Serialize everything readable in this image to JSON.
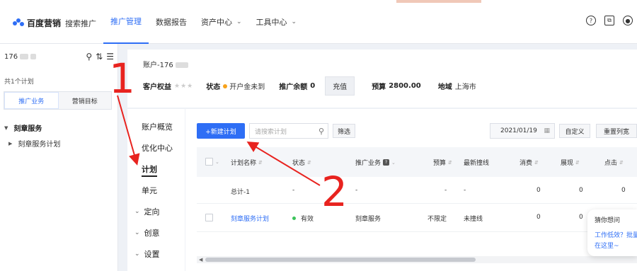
{
  "header": {
    "brand": "百度营销",
    "product": "搜索推广",
    "nav": [
      {
        "label": "推广管理",
        "active": true,
        "dropdown": false
      },
      {
        "label": "数据报告",
        "active": false,
        "dropdown": false
      },
      {
        "label": "资产中心",
        "active": false,
        "dropdown": true
      },
      {
        "label": "工具中心",
        "active": false,
        "dropdown": true
      }
    ],
    "icons": [
      "help-icon",
      "copy-icon",
      "user-icon"
    ]
  },
  "sidebar": {
    "account_prefix": "176",
    "plan_count": "共1个计划",
    "tabs": [
      {
        "label": "推广业务",
        "active": true
      },
      {
        "label": "营销目标",
        "active": false
      }
    ],
    "group": "刻章服务",
    "item": "刻章服务计划"
  },
  "account": {
    "title": "账户-176",
    "rights_label": "客户权益",
    "status_label": "状态",
    "status_value": "开户金未到",
    "balance_label": "推广余额",
    "balance_value": "0",
    "recharge_label": "充值",
    "budget_label": "预算",
    "budget_value": "2800.00",
    "region_label": "地域",
    "region_value": "上海市"
  },
  "subnav": [
    {
      "label": "账户概览",
      "active": false,
      "expandable": false
    },
    {
      "label": "优化中心",
      "active": false,
      "expandable": false
    },
    {
      "label": "计划",
      "active": true,
      "expandable": false
    },
    {
      "label": "单元",
      "active": false,
      "expandable": false
    },
    {
      "label": "定向",
      "active": false,
      "expandable": true
    },
    {
      "label": "创意",
      "active": false,
      "expandable": true
    },
    {
      "label": "设置",
      "active": false,
      "expandable": true
    }
  ],
  "toolbar": {
    "new_plan": "+新建计划",
    "search_placeholder": "请搜索计划",
    "filter": "筛选",
    "date": "2021/01/19",
    "custom": "自定义",
    "reset_columns": "重置列宽"
  },
  "table": {
    "headers": [
      "计划名称",
      "状态",
      "推广业务",
      "预算",
      "最新撞线",
      "消费",
      "展现",
      "点击"
    ],
    "total_row": [
      "总计-1",
      "-",
      "-",
      "-",
      "-",
      "0",
      "0",
      "0"
    ],
    "rows": [
      [
        "刻章服务计划",
        "有效",
        "刻章服务",
        "不限定",
        "未撞线",
        "0",
        "0",
        ""
      ]
    ]
  },
  "assistant": {
    "line1": "猜你想问",
    "line2": "工作低效？批量",
    "line3": "在这里~"
  },
  "annotations": [
    "1",
    "2"
  ],
  "colors": {
    "accent": "#2e6ef5",
    "annotation": "#e8231f",
    "status_ok": "#3cc35a",
    "status_warn": "#f7a21b"
  }
}
